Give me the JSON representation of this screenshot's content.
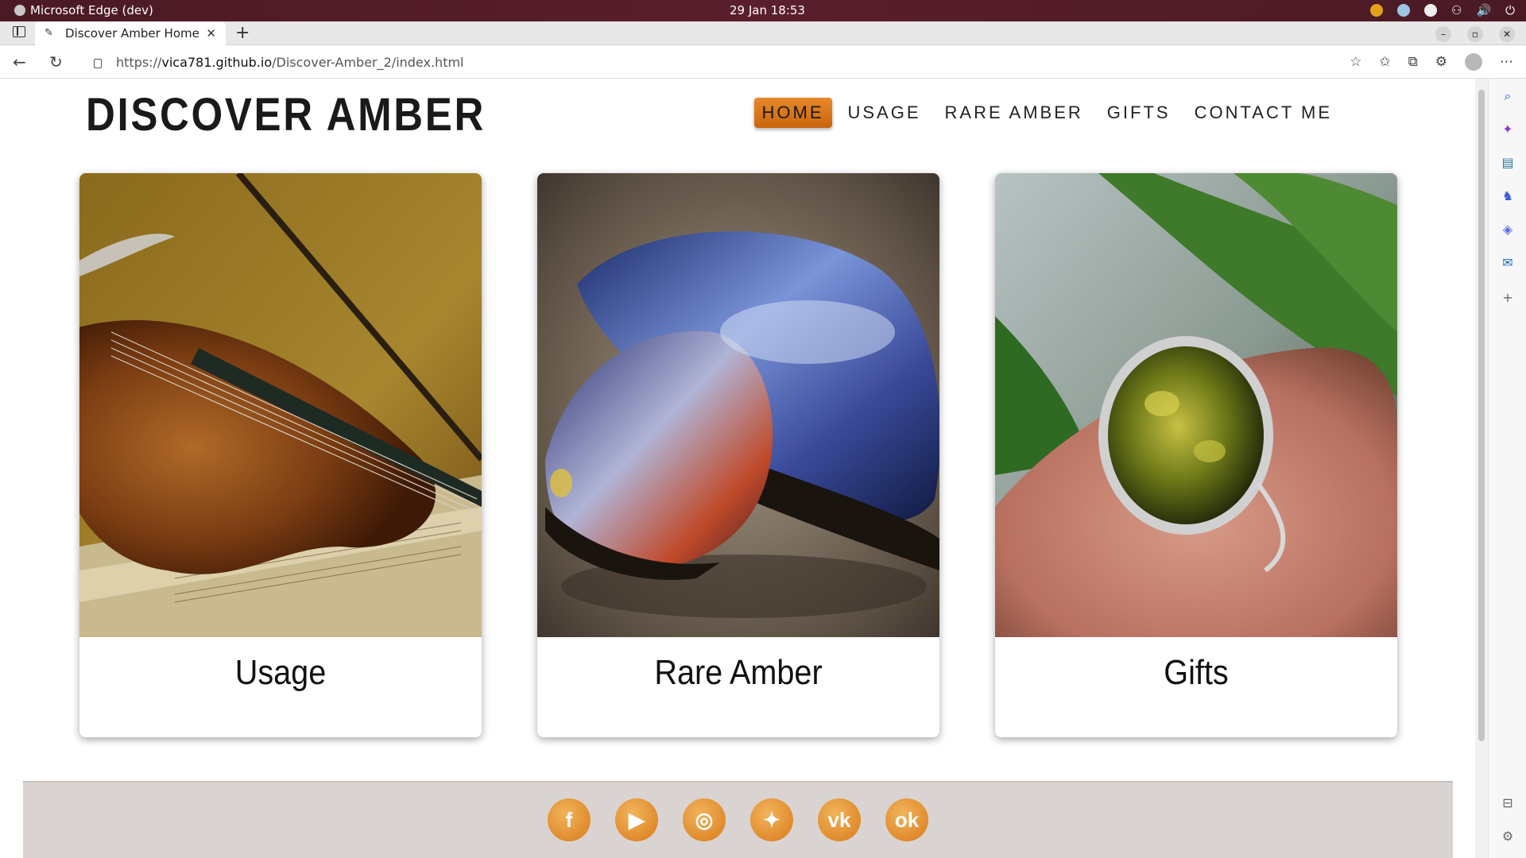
{
  "os": {
    "app_name": "Microsoft Edge (dev)",
    "clock": "29 Jan  18:53"
  },
  "browser": {
    "tab_title": "Discover Amber Home",
    "url_scheme": "https://",
    "url_host": "vica781.github.io",
    "url_path": "/Discover-Amber_2/index.html"
  },
  "site": {
    "logo": "DISCOVER AMBER",
    "nav": [
      "HOME",
      "USAGE",
      "RARE AMBER",
      "GIFTS",
      "CONTACT ME"
    ],
    "active_nav": "HOME",
    "accent_color": "#d9761b",
    "cards": [
      {
        "title": "Usage",
        "image": "violin-on-sheet-music"
      },
      {
        "title": "Rare Amber",
        "image": "blue-amber-stones"
      },
      {
        "title": "Gifts",
        "image": "green-amber-ring-on-hand"
      }
    ],
    "social": [
      "facebook-icon",
      "youtube-icon",
      "instagram-icon",
      "twitter-icon",
      "vk-icon",
      "odnoklassniki-icon"
    ]
  }
}
